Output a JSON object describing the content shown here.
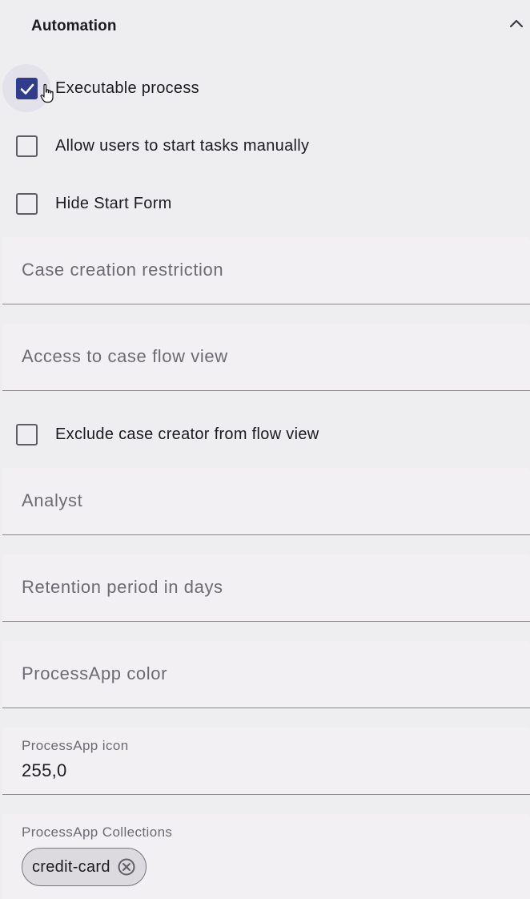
{
  "section": {
    "title": "Automation",
    "collapse_icon": "chevron-up-icon"
  },
  "checkboxes": [
    {
      "label": "Executable process",
      "checked": true
    },
    {
      "label": "Allow users to start tasks manually",
      "checked": false
    },
    {
      "label": "Hide Start Form",
      "checked": false
    },
    {
      "label": "Exclude case creator from flow view",
      "checked": false
    }
  ],
  "fields": {
    "case_creation_restriction": {
      "label": "Case creation restriction",
      "value": ""
    },
    "access_flow_view": {
      "label": "Access to case flow view",
      "value": ""
    },
    "analyst": {
      "label": "Analyst",
      "value": ""
    },
    "retention_period": {
      "label": "Retention period in days",
      "value": ""
    },
    "app_color": {
      "label": "ProcessApp color",
      "value": ""
    },
    "app_icon": {
      "label": "ProcessApp icon",
      "value": "255,0"
    },
    "collections": {
      "label": "ProcessApp Collections",
      "chips": [
        {
          "label": "credit-card",
          "remove_icon": "close-circle-icon"
        }
      ]
    }
  },
  "colors": {
    "accent": "#2f3d8c",
    "background": "#eeedf0",
    "field_background": "#f3f0f4"
  }
}
